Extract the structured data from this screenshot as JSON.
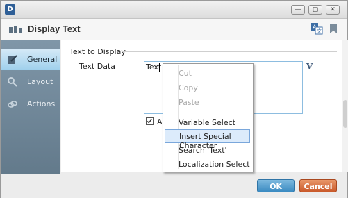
{
  "window": {
    "app_icon_text": "D",
    "title_icon": "app-logo-icon"
  },
  "header": {
    "title": "Display Text"
  },
  "sidebar": {
    "items": [
      {
        "label": "General",
        "icon": "general-icon",
        "active": true
      },
      {
        "label": "Layout",
        "icon": "layout-icon",
        "active": false
      },
      {
        "label": "Actions",
        "icon": "actions-icon",
        "active": false
      }
    ]
  },
  "content": {
    "section_title": "Text to Display",
    "text_data_label": "Text Data",
    "text_value": "Text",
    "checkbox_label": "Au"
  },
  "context_menu": {
    "items": [
      {
        "label": "Cut",
        "disabled": true
      },
      {
        "label": "Copy",
        "disabled": true
      },
      {
        "label": "Paste",
        "disabled": true
      },
      {
        "label": "Variable Select",
        "disabled": false
      },
      {
        "label": "Insert Special Character",
        "disabled": false,
        "highlighted": true
      },
      {
        "label": "Search 'Text'",
        "disabled": false
      },
      {
        "label": "Localization Select",
        "disabled": false
      }
    ]
  },
  "footer": {
    "ok_label": "OK",
    "cancel_label": "Cancel"
  },
  "colors": {
    "accent": "#3a8ac1",
    "cancel": "#c9592a",
    "sidebar": "#6d8495",
    "highlight": "#dcebfb"
  }
}
